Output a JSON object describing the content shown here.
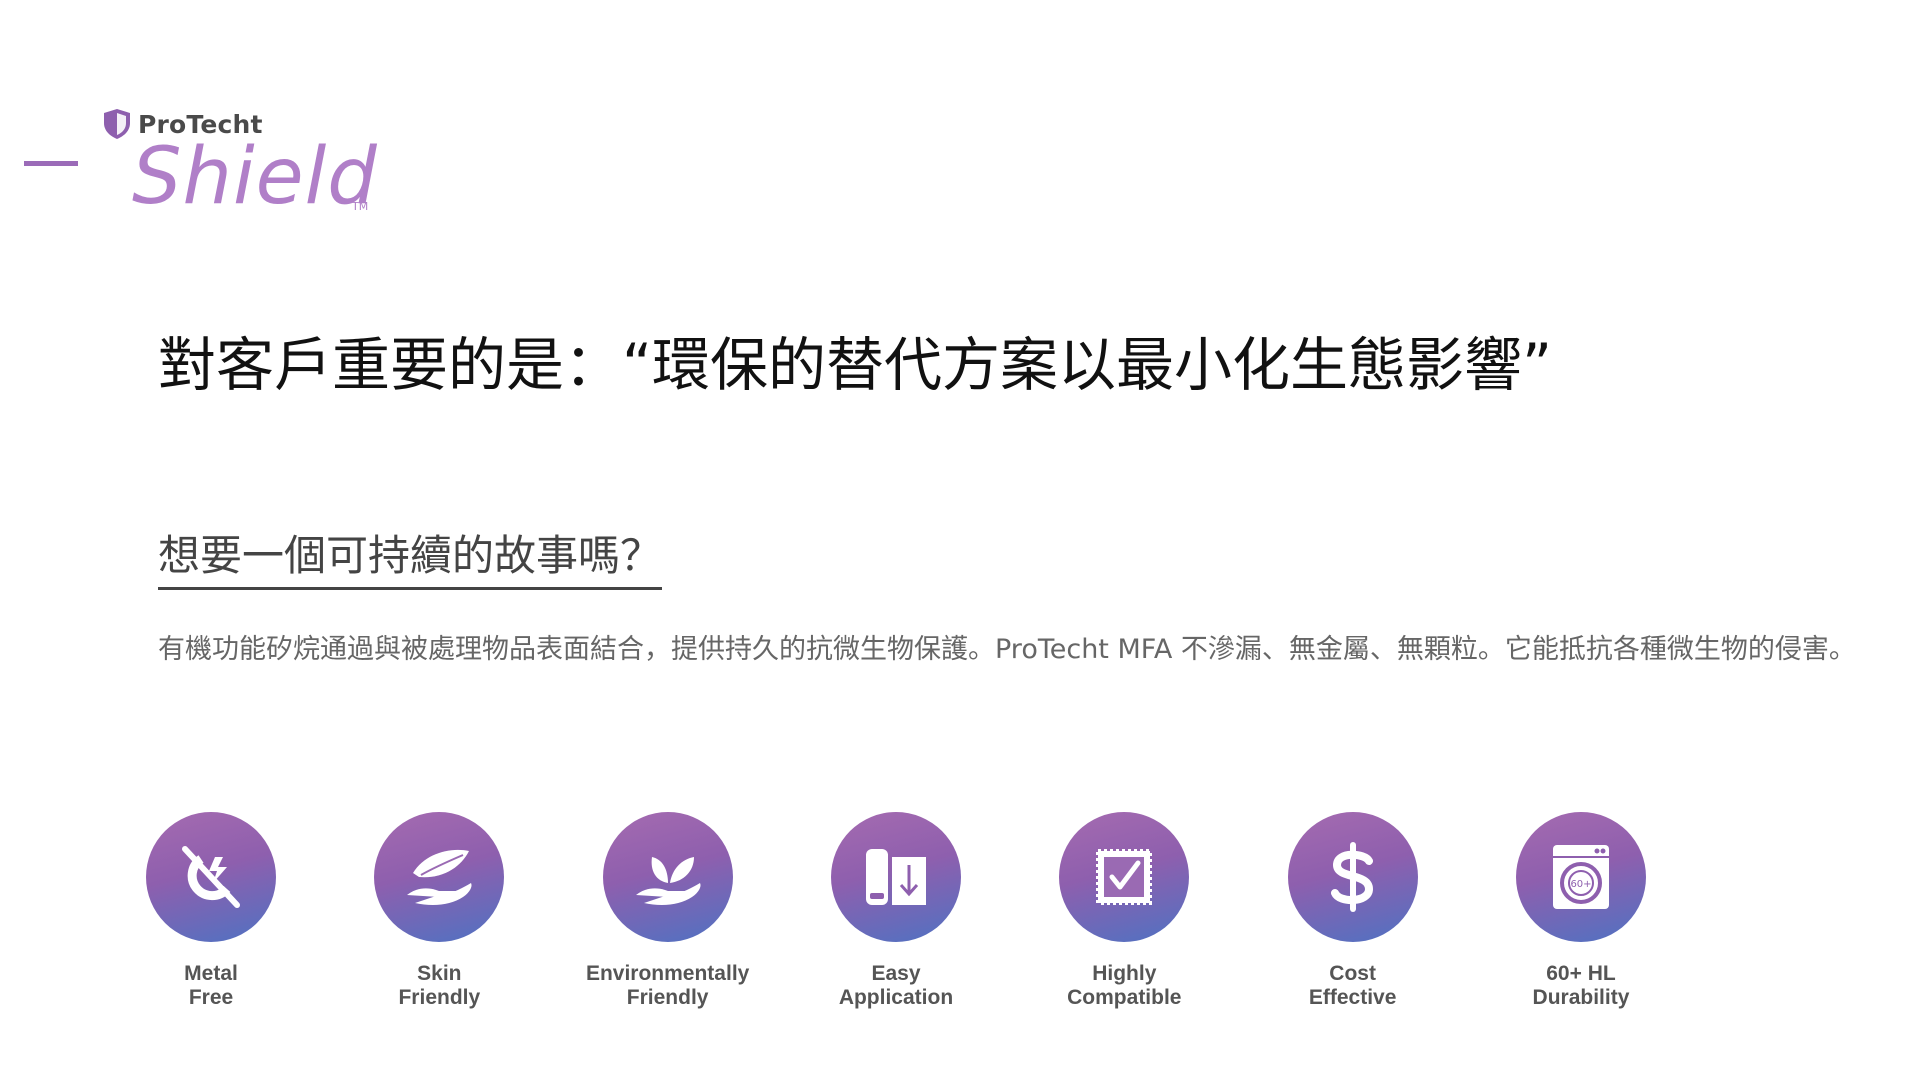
{
  "logo": {
    "brand": "ProTecht",
    "product": "Shield",
    "tm": "TM"
  },
  "headline": "對客戶重要的是：“環保的替代方案以最小化生態影響”",
  "subhead": "想要一個可持續的故事嗎？",
  "body": "有機功能矽烷通過與被處理物品表面結合，提供持久的抗微生物保護。ProTecht MFA 不滲漏、無金屬、無顆粒。它能抵抗各種微生物的侵害。",
  "colors": {
    "accent": "#b07fc8",
    "icon_gradient_top": "#a56bb0",
    "icon_gradient_bottom": "#4f72c2"
  },
  "features": [
    {
      "icon": "metal-free-icon",
      "line1": "Metal",
      "line2": "Free"
    },
    {
      "icon": "skin-friendly-icon",
      "line1": "Skin",
      "line2": "Friendly"
    },
    {
      "icon": "eco-friendly-icon",
      "line1": "Environmentally",
      "line2": "Friendly"
    },
    {
      "icon": "easy-application-icon",
      "line1": "Easy",
      "line2": "Application"
    },
    {
      "icon": "compatible-icon",
      "line1": "Highly",
      "line2": "Compatible"
    },
    {
      "icon": "cost-effective-icon",
      "line1": "Cost",
      "line2": "Effective"
    },
    {
      "icon": "durability-icon",
      "line1": "60+ HL",
      "line2": "Durability",
      "badge": "60+"
    }
  ]
}
